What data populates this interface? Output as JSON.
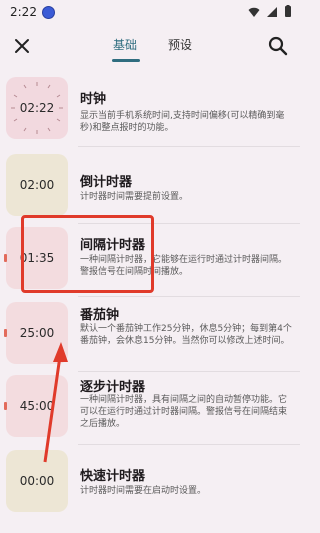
{
  "status": {
    "time": "2:22"
  },
  "tabs": [
    {
      "label": "基础",
      "active": true
    },
    {
      "label": "预设",
      "active": false
    }
  ],
  "accent": "#2f6d7f",
  "items": [
    {
      "title": "时钟",
      "thumb": "02:22",
      "desc": "显示当前手机系统时间,支持时间偏移(可以精确到毫秒)和整点报时的功能。"
    },
    {
      "title": "倒计时器",
      "thumb": "02:00",
      "desc": "计时器时间需要提前设置。"
    },
    {
      "title": "间隔计时器",
      "thumb": "01:35",
      "desc": "一种间隔计时器，它能够在运行时通过计时器间隔。警报信号在间隔时间播放。"
    },
    {
      "title": "番茄钟",
      "thumb": "25:00",
      "desc": "默认一个番茄钟工作25分钟，休息5分钟；每到第4个番茄钟，会休息15分钟。当然你可以修改上述时间。"
    },
    {
      "title": "逐步计时器",
      "thumb": "45:00",
      "desc": "一种间隔计时器，具有间隔之间的自动暂停功能。它可以在运行时通过计时器间隔。警报信号在间隔结束之后播放。"
    },
    {
      "title": "快速计时器",
      "thumb": "00:00",
      "desc": "计时器时间需要在启动时设置。"
    }
  ],
  "annotation_color": "#e03a2a"
}
